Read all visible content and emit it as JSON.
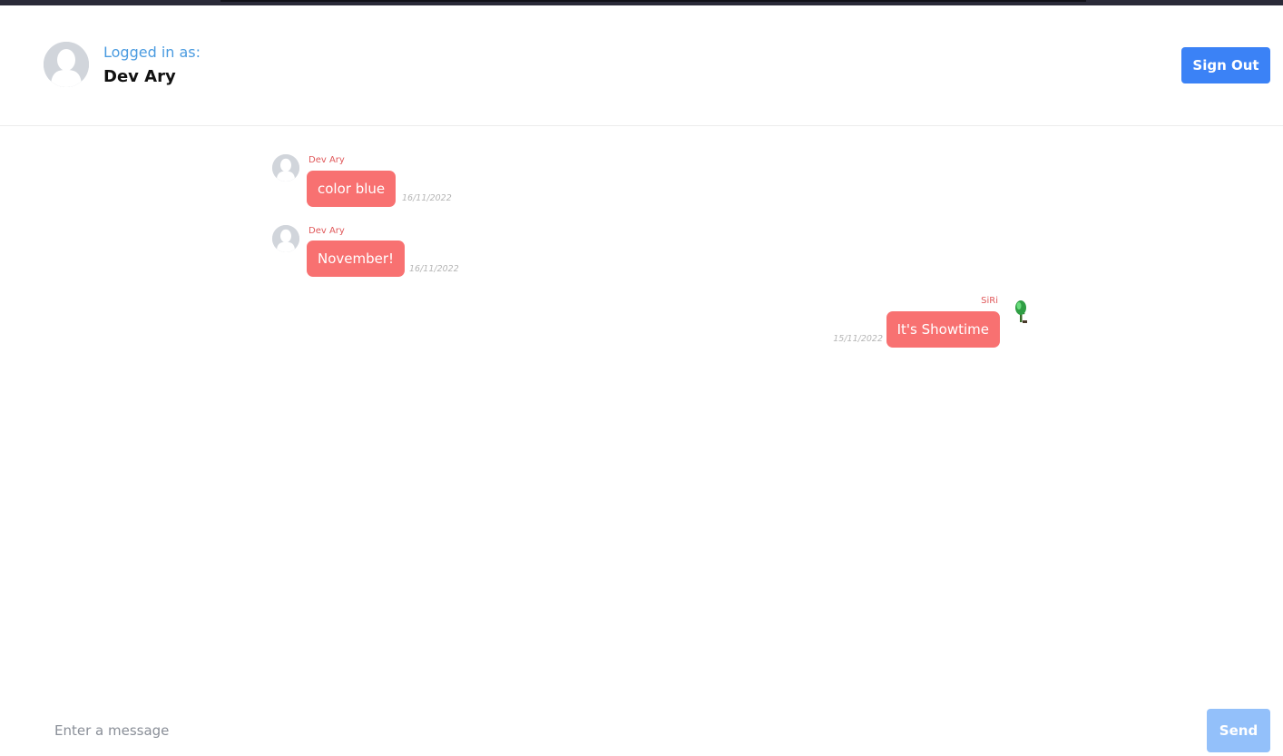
{
  "header": {
    "logged_in_label": "Logged in as:",
    "user_name": "Dev Ary",
    "sign_out_label": "Sign Out"
  },
  "messages": [
    {
      "sender": "Dev Ary",
      "text": "color blue",
      "date": "16/11/2022",
      "side": "left",
      "avatar": "default-avatar-icon"
    },
    {
      "sender": "Dev Ary",
      "text": "November!",
      "date": "16/11/2022",
      "side": "left",
      "avatar": "default-avatar-icon"
    },
    {
      "sender": "SiRi",
      "text": "It's Showtime",
      "date": "15/11/2022",
      "side": "right",
      "avatar": "plant-avatar-icon"
    }
  ],
  "composer": {
    "placeholder": "Enter a message",
    "value": "",
    "send_label": "Send"
  },
  "colors": {
    "accent": "#3b82f6",
    "bubble": "#f87171",
    "sender_name": "#e0585a",
    "logged_label": "#4a9be0"
  }
}
